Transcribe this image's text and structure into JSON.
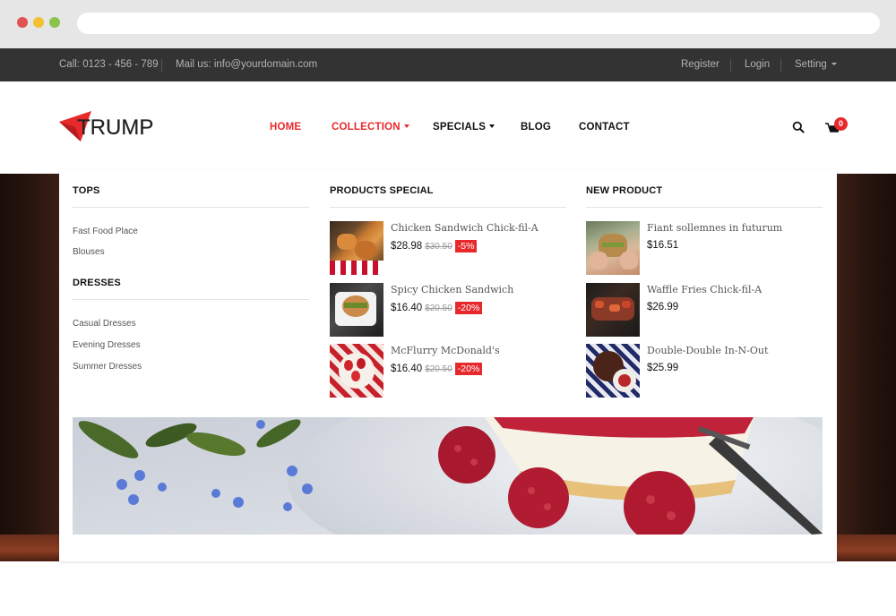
{
  "topbar": {
    "call": "Call: 0123 - 456 - 789",
    "mail": "Mail us: info@yourdomain.com",
    "register": "Register",
    "login": "Login",
    "setting": "Setting"
  },
  "logo": {
    "text": "TRUMP"
  },
  "nav": {
    "home": "HOME",
    "collection": "COLLECTION",
    "specials": "SPECIALS",
    "blog": "BLOG",
    "contact": "CONTACT"
  },
  "cart": {
    "count": "0"
  },
  "mega": {
    "tops": {
      "title": "TOPS",
      "links": [
        "Fast Food Place",
        "Blouses"
      ]
    },
    "dresses": {
      "title": "DRESSES",
      "links": [
        "Casual Dresses",
        "Evening Dresses",
        "Summer Dresses"
      ]
    },
    "special": {
      "title": "PRODUCTS SPECIAL",
      "items": [
        {
          "name": "Chicken Sandwich Chick-fil-A",
          "price": "$28.98",
          "old": "$30.50",
          "discount": "-5%"
        },
        {
          "name": "Spicy Chicken Sandwich",
          "price": "$16.40",
          "old": "$20.50",
          "discount": "-20%"
        },
        {
          "name": "McFlurry McDonald's",
          "price": "$16.40",
          "old": "$20.50",
          "discount": "-20%"
        }
      ]
    },
    "newproduct": {
      "title": "NEW PRODUCT",
      "items": [
        {
          "name": "Fiant sollemnes in futurum",
          "price": "$16.51"
        },
        {
          "name": "Waffle Fries Chick-fil-A",
          "price": "$26.99"
        },
        {
          "name": "Double-Double In-N-Out",
          "price": "$25.99"
        }
      ]
    }
  },
  "colors": {
    "accent": "#e8292c",
    "topbar": "#333333",
    "chrome": "#e6e6e6"
  }
}
